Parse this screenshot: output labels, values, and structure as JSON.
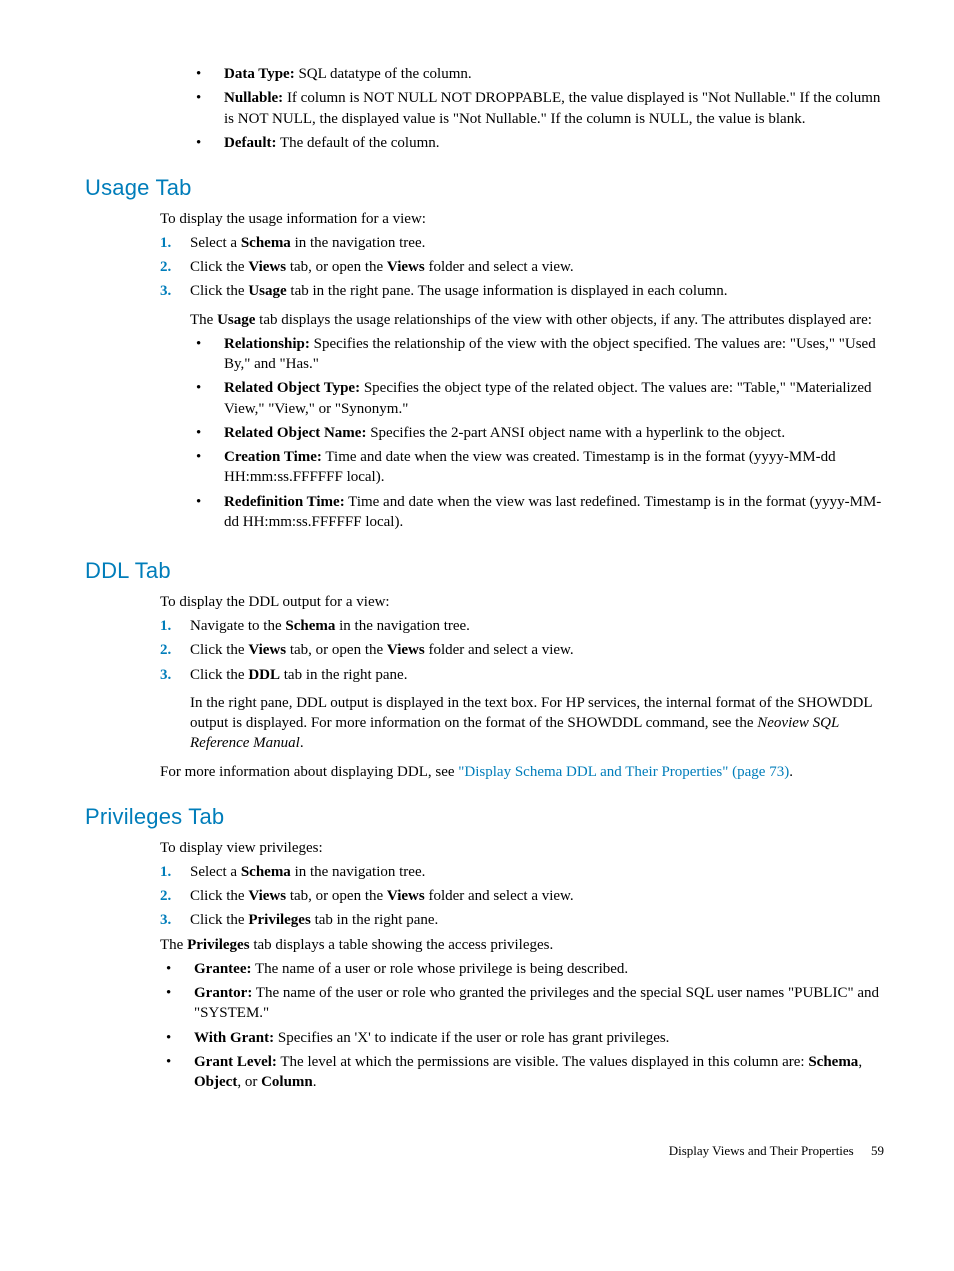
{
  "top_bullets": [
    {
      "label": "Data Type:",
      "text": " SQL datatype of the column."
    },
    {
      "label": "Nullable:",
      "text": " If column is NOT NULL NOT DROPPABLE, the value displayed is \"Not Nullable.\" If the column is NOT NULL, the displayed value is \"Not Nullable.\" If the column is NULL, the value is blank."
    },
    {
      "label": "Default:",
      "text": " The default of the column."
    }
  ],
  "usage": {
    "heading": "Usage Tab",
    "intro": "To display the usage information for a view:",
    "steps": [
      {
        "n": "1.",
        "pre": "Select a ",
        "bold": "Schema",
        "post": " in the navigation tree."
      },
      {
        "n": "2.",
        "pre": "Click the ",
        "bold": "Views",
        "mid": " tab, or open the ",
        "bold2": "Views",
        "post": " folder and select a view."
      },
      {
        "n": "3.",
        "pre": "Click the ",
        "bold": "Usage",
        "post": " tab in the right pane. The usage information is displayed in each column."
      }
    ],
    "sub_intro_pre": "The ",
    "sub_intro_bold": "Usage",
    "sub_intro_post": " tab displays the usage relationships of the view with other objects, if any. The attributes displayed are:",
    "bullets": [
      {
        "label": "Relationship:",
        "text": " Specifies the relationship of the view with the object specified. The values are: \"Uses,\" \"Used By,\" and \"Has.\""
      },
      {
        "label": "Related Object Type:",
        "text": " Specifies the object type of the related object. The values are: \"Table,\" \"Materialized View,\" \"View,\" or \"Synonym.\""
      },
      {
        "label": "Related Object Name:",
        "text": " Specifies the 2-part ANSI object name with a hyperlink to the object."
      },
      {
        "label": "Creation Time:",
        "text": " Time and date when the view was created. Timestamp is in the format (yyyy-MM-dd HH:mm:ss.FFFFFF local)."
      },
      {
        "label": "Redefinition Time:",
        "text": " Time and date when the view was last redefined. Timestamp is in the format (yyyy-MM-dd HH:mm:ss.FFFFFF local)."
      }
    ]
  },
  "ddl": {
    "heading": "DDL Tab",
    "intro": "To display the DDL output for a view:",
    "steps": [
      {
        "n": "1.",
        "pre": "Navigate to the ",
        "bold": "Schema",
        "post": " in the navigation tree."
      },
      {
        "n": "2.",
        "pre": "Click the ",
        "bold": "Views",
        "mid": " tab, or open the ",
        "bold2": "Views",
        "post": " folder and select a view."
      },
      {
        "n": "3.",
        "pre": "Click the ",
        "bold": "DDL",
        "post": " tab in the right pane."
      }
    ],
    "sub_text_pre": "In the right pane, DDL output is displayed in the text box. For HP services, the internal format of the SHOWDDL output is displayed. For more information on the format of the SHOWDDL command, see the ",
    "sub_text_italic": "Neoview SQL Reference Manual",
    "sub_text_post": ".",
    "more_pre": "For more information about displaying DDL, see ",
    "more_link": "\"Display Schema DDL and Their Properties\" (page 73)",
    "more_post": "."
  },
  "priv": {
    "heading": "Privileges Tab",
    "intro": "To display view privileges:",
    "steps": [
      {
        "n": "1.",
        "pre": "Select a ",
        "bold": "Schema",
        "post": " in the navigation tree."
      },
      {
        "n": "2.",
        "pre": "Click the ",
        "bold": "Views",
        "mid": " tab, or open the ",
        "bold2": "Views",
        "post": " folder and select a view."
      },
      {
        "n": "3.",
        "pre": "Click the ",
        "bold": "Privileges",
        "post": " tab in the right pane."
      }
    ],
    "table_intro_pre": "The ",
    "table_intro_bold": "Privileges",
    "table_intro_post": " tab displays a table showing the access privileges.",
    "bullets": [
      {
        "label": "Grantee:",
        "text": " The name of a user or role whose privilege is being described."
      },
      {
        "label": "Grantor:",
        "text": " The name of the user or role who granted the privileges and the special SQL user names \"PUBLIC\" and \"SYSTEM.\""
      },
      {
        "label": "With Grant:",
        "text": " Specifies an 'X' to indicate if the user or role has grant privileges."
      },
      {
        "label": "Grant Level:",
        "text_pre": " The level at which the permissions are visible. The values displayed in this column are: ",
        "b1": "Schema",
        "c1": ", ",
        "b2": "Object",
        "c2": ", or ",
        "b3": "Column",
        "c3": "."
      }
    ]
  },
  "footer": {
    "title": "Display Views and Their Properties",
    "page": "59"
  }
}
